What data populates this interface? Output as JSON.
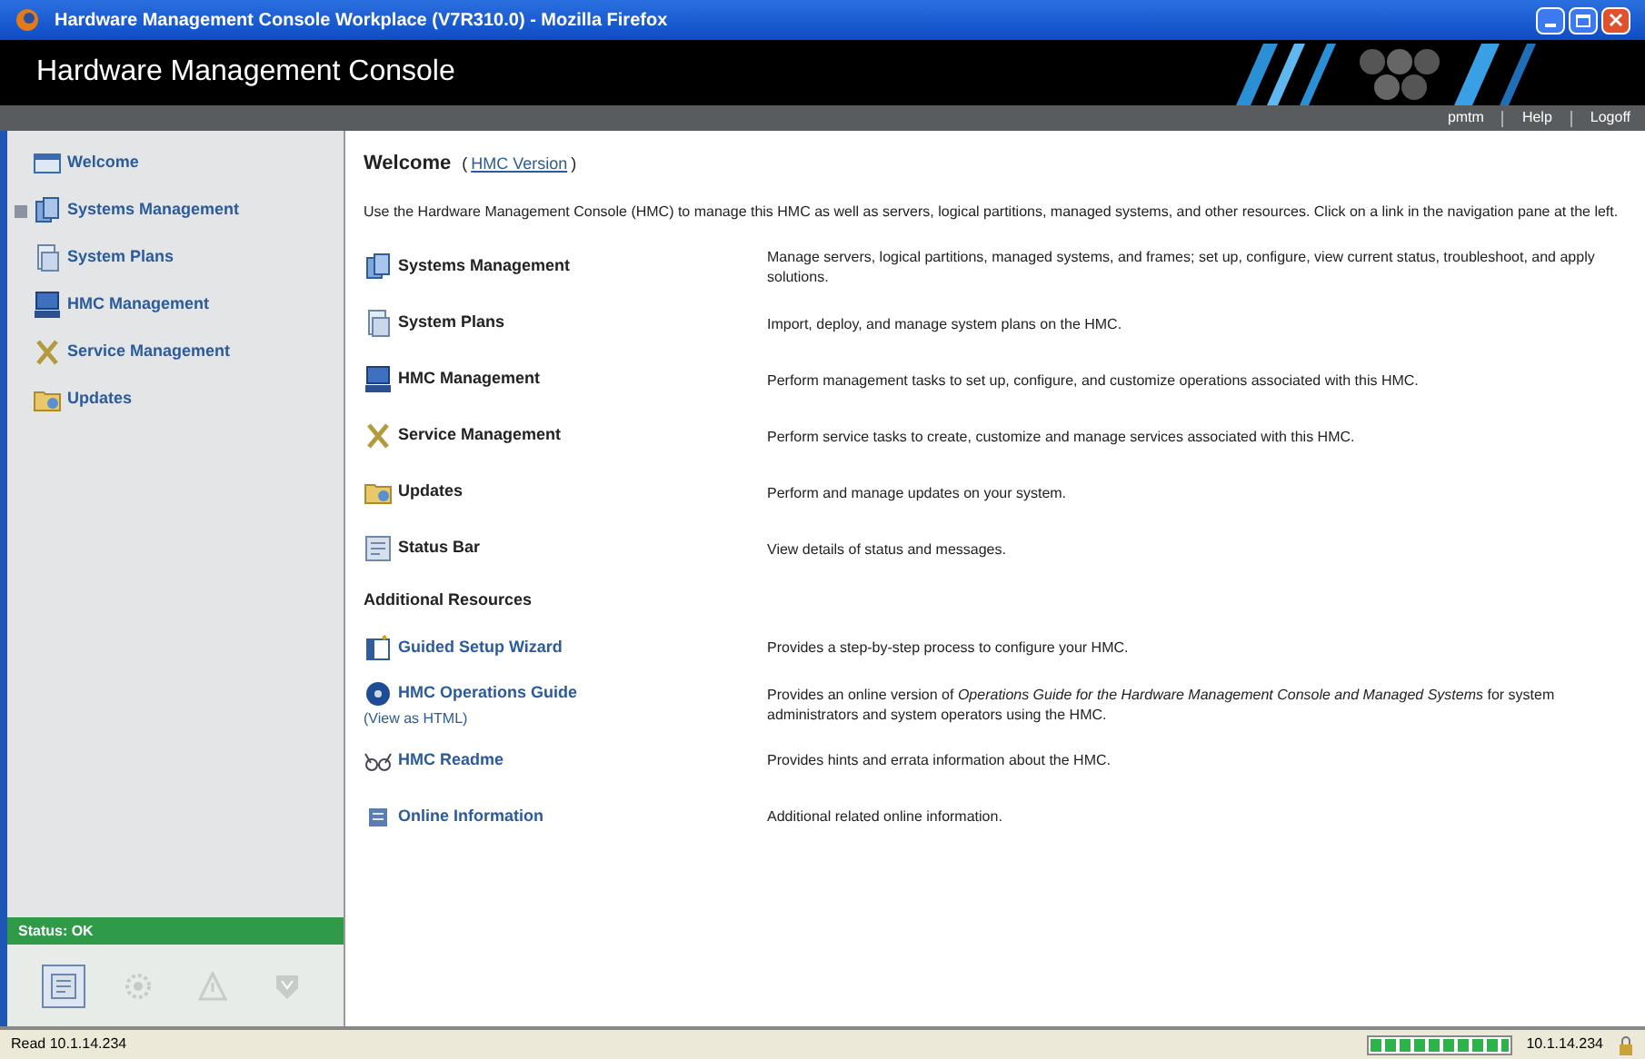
{
  "window": {
    "title": "Hardware Management Console Workplace (V7R310.0) - Mozilla Firefox"
  },
  "header": {
    "title": "Hardware Management Console",
    "links": [
      "pmtm",
      "Help",
      "Logoff"
    ]
  },
  "sidebar": {
    "items": [
      {
        "label": "Welcome",
        "expandable": false
      },
      {
        "label": "Systems Management",
        "expandable": true
      },
      {
        "label": "System Plans",
        "expandable": false
      },
      {
        "label": "HMC Management",
        "expandable": false
      },
      {
        "label": "Service Management",
        "expandable": false
      },
      {
        "label": "Updates",
        "expandable": false
      }
    ],
    "status": "Status: OK",
    "status_icons": [
      {
        "disabled": false
      },
      {
        "disabled": true
      },
      {
        "disabled": true
      },
      {
        "disabled": true
      }
    ]
  },
  "content": {
    "title": "Welcome",
    "title_open": "(",
    "title_link": "HMC Version",
    "title_close": ")",
    "intro": "Use the Hardware Management Console (HMC) to manage this HMC as well as servers, logical partitions, managed systems, and other resources. Click on a link in the navigation pane at the left.",
    "tasks": [
      {
        "label": "Systems Management",
        "description": "Manage servers, logical partitions, managed systems, and frames; set up, configure, view current status, troubleshoot, and apply solutions."
      },
      {
        "label": "System Plans",
        "description": "Import, deploy, and manage system plans on the HMC."
      },
      {
        "label": "HMC Management",
        "description": "Perform management tasks to set up, configure, and customize operations associated with this HMC."
      },
      {
        "label": "Service Management",
        "description": "Perform service tasks to create, customize and manage services associated with this HMC."
      },
      {
        "label": "Updates",
        "description": "Perform and manage updates on your system."
      },
      {
        "label": "Status Bar",
        "description": "View details of status and messages."
      }
    ],
    "resources_heading": "Additional Resources",
    "resources": [
      {
        "label": "Guided Setup Wizard",
        "description": "Provides a step-by-step process to configure your HMC."
      },
      {
        "label": "HMC Operations Guide",
        "sublabel": "(View as HTML)",
        "description": "Provides an online version of *Operations Guide for the Hardware Management Console and Managed Systems* for system administrators and system operators using the HMC."
      },
      {
        "label": "HMC Readme",
        "description": "Provides hints and errata information about the HMC."
      },
      {
        "label": "Online Information",
        "description": "Additional related online information."
      }
    ]
  },
  "status_bar": {
    "text": "Read 10.1.14.234",
    "progress": {
      "level": 1
    },
    "address": "10.1.14.234"
  }
}
